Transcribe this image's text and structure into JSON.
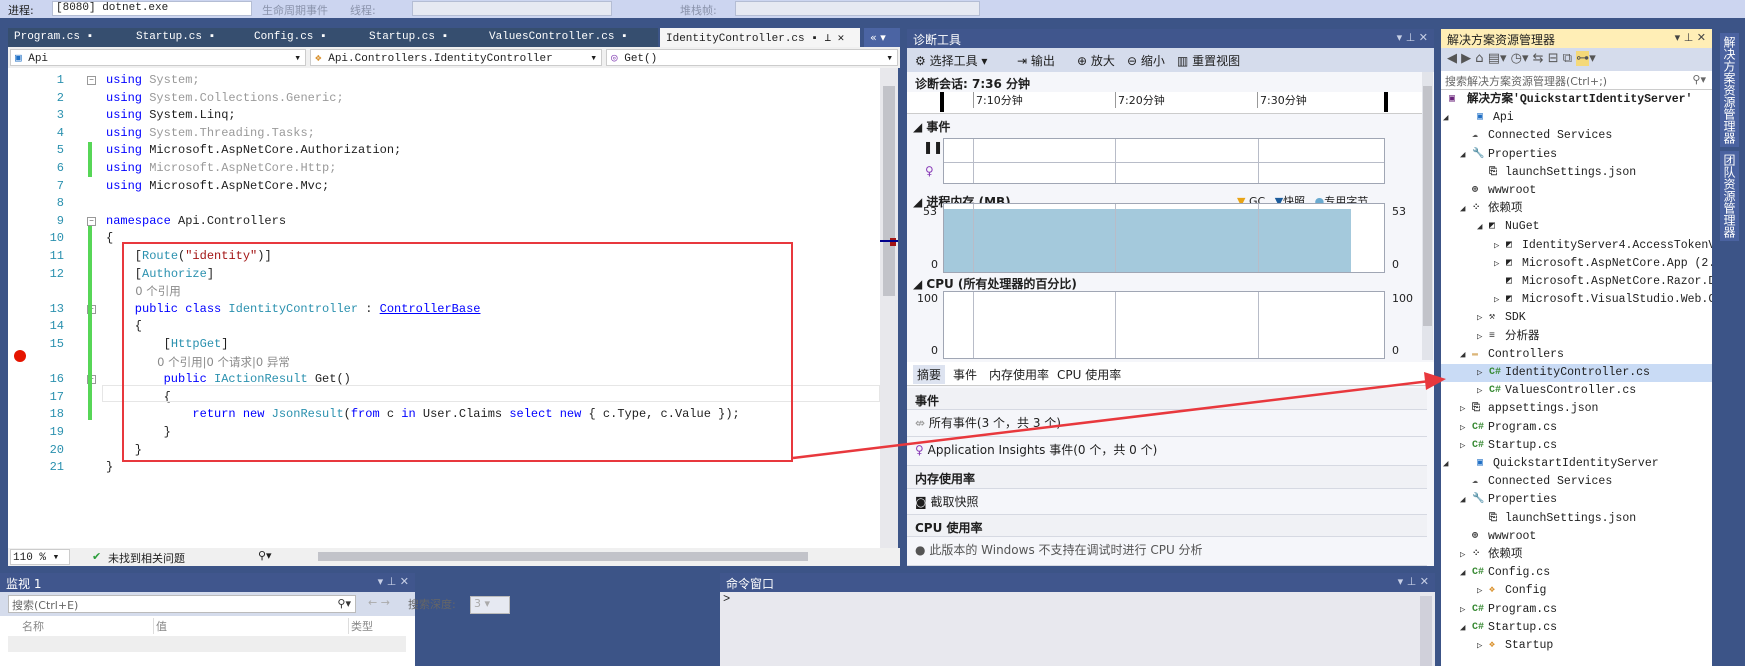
{
  "toolbar": {
    "process_label": "进程:",
    "process_value": "[8080] dotnet.exe",
    "lifecycle": "生命周期事件",
    "thread_label": "线程:",
    "stack_label": "堆栈帧:"
  },
  "tabs": [
    {
      "label": "Program.cs"
    },
    {
      "label": "Startup.cs"
    },
    {
      "label": "Config.cs"
    },
    {
      "label": "Startup.cs"
    },
    {
      "label": "ValuesController.cs"
    },
    {
      "label": "IdentityController.cs",
      "active": true
    }
  ],
  "nav": {
    "project": "Api",
    "class": "Api.Controllers.IdentityController",
    "member": "Get()"
  },
  "code": [
    {
      "n": "1",
      "t": [
        [
          "kw",
          "using "
        ],
        [
          "gr",
          "System;"
        ]
      ]
    },
    {
      "n": "2",
      "t": [
        [
          "kw",
          "using "
        ],
        [
          "gr",
          "System.Collections.Generic;"
        ]
      ]
    },
    {
      "n": "3",
      "t": [
        [
          "kw",
          "using "
        ],
        [
          "pl",
          "System.Linq;"
        ]
      ]
    },
    {
      "n": "4",
      "t": [
        [
          "kw",
          "using "
        ],
        [
          "gr",
          "System.Threading.Tasks;"
        ]
      ]
    },
    {
      "n": "5",
      "t": [
        [
          "kw",
          "using "
        ],
        [
          "pl",
          "Microsoft.AspNetCore.Authorization;"
        ]
      ]
    },
    {
      "n": "6",
      "t": [
        [
          "kw",
          "using "
        ],
        [
          "gr",
          "Microsoft.AspNetCore.Http;"
        ]
      ]
    },
    {
      "n": "7",
      "t": [
        [
          "kw",
          "using "
        ],
        [
          "pl",
          "Microsoft.AspNetCore.Mvc;"
        ]
      ]
    },
    {
      "n": "8",
      "t": []
    },
    {
      "n": "9",
      "t": [
        [
          "kw",
          "namespace "
        ],
        [
          "pl",
          "Api.Controllers"
        ]
      ]
    },
    {
      "n": "10",
      "t": [
        [
          "pl",
          "{"
        ]
      ]
    },
    {
      "n": "11",
      "t": [
        [
          "pl",
          "    ["
        ],
        [
          "ty",
          "Route"
        ],
        [
          "pl",
          "("
        ],
        [
          "st",
          "\"identity\""
        ],
        [
          "pl",
          ")]"
        ]
      ]
    },
    {
      "n": "12",
      "t": [
        [
          "pl",
          "    ["
        ],
        [
          "ty",
          "Authorize"
        ],
        [
          "pl",
          "]"
        ]
      ]
    },
    {
      "n": "",
      "t": [
        [
          "lens",
          "        0 个引用"
        ]
      ]
    },
    {
      "n": "13",
      "t": [
        [
          "kw",
          "    public class "
        ],
        [
          "ty",
          "IdentityController"
        ],
        [
          "pl",
          " : "
        ],
        [
          "lk",
          "ControllerBase"
        ]
      ]
    },
    {
      "n": "14",
      "t": [
        [
          "pl",
          "    {"
        ]
      ]
    },
    {
      "n": "15",
      "t": [
        [
          "pl",
          "        ["
        ],
        [
          "ty",
          "HttpGet"
        ],
        [
          "pl",
          "]"
        ]
      ]
    },
    {
      "n": "",
      "t": [
        [
          "lens",
          "              0 个引用|0 个请求|0 异常"
        ]
      ]
    },
    {
      "n": "16",
      "t": [
        [
          "kw",
          "        public "
        ],
        [
          "ty",
          "IActionResult "
        ],
        [
          "pl",
          "Get()"
        ]
      ]
    },
    {
      "n": "17",
      "t": [
        [
          "pl",
          "        {"
        ]
      ]
    },
    {
      "n": "18",
      "t": [
        [
          "kw",
          "            return new "
        ],
        [
          "ty",
          "JsonResult"
        ],
        [
          "pl",
          "("
        ],
        [
          "kw",
          "from "
        ],
        [
          "pl",
          "c "
        ],
        [
          "kw",
          "in "
        ],
        [
          "pl",
          "User.Claims "
        ],
        [
          "kw",
          "select new "
        ],
        [
          "pl",
          "{ c.Type, c.Value });"
        ]
      ]
    },
    {
      "n": "19",
      "t": [
        [
          "pl",
          "        }"
        ]
      ]
    },
    {
      "n": "20",
      "t": [
        [
          "pl",
          "    }"
        ]
      ]
    },
    {
      "n": "21",
      "t": [
        [
          "pl",
          "}"
        ]
      ]
    }
  ],
  "editor_status": {
    "zoom": "110 %",
    "issues": "未找到相关问题"
  },
  "diag": {
    "title": "诊断工具",
    "select_tools": "选择工具",
    "output": "输出",
    "zoom_in": "放大",
    "zoom_out": "缩小",
    "reset_view": "重置视图",
    "session": "诊断会话: 7:36 分钟",
    "timeline": [
      "7:10分钟",
      "7:20分钟",
      "7:30分钟"
    ],
    "events_label": "事件",
    "memory_label": "进程内存 (MB)",
    "legend": [
      "GC",
      "快照",
      "专用字节"
    ],
    "mem_max": "53",
    "mem_min": "0",
    "mem_value": 53,
    "cpu_label": "CPU (所有处理器的百分比)",
    "cpu_max": "100",
    "cpu_min": "0",
    "tabs": [
      "摘要",
      "事件",
      "内存使用率",
      "CPU 使用率"
    ],
    "sections": {
      "events": "事件",
      "all_events": "所有事件(3 个，共 3 个)",
      "ai_events": "Application Insights 事件(0 个，共 0 个)",
      "memory": "内存使用率",
      "snapshot": "截取快照",
      "cpu": "CPU 使用率",
      "cpu_note": "此版本的 Windows 不支持在调试时进行 CPU 分析"
    }
  },
  "solution": {
    "title": "解决方案资源管理器",
    "search_placeholder": "搜索解决方案资源管理器(Ctrl+;)",
    "items": [
      {
        "lvl": 0,
        "exp": "",
        "icon": "solution",
        "label": "解决方案'QuickstartIdentityServer'",
        "bold": true
      },
      {
        "lvl": 0,
        "exp": "open",
        "icon": "web-project",
        "label": "Api"
      },
      {
        "lvl": 1,
        "exp": "",
        "icon": "cloud",
        "label": "Connected Services"
      },
      {
        "lvl": 1,
        "exp": "open",
        "icon": "wrench",
        "label": "Properties"
      },
      {
        "lvl": 2,
        "exp": "",
        "icon": "json",
        "label": "launchSettings.json"
      },
      {
        "lvl": 1,
        "exp": "",
        "icon": "globe",
        "label": "wwwroot"
      },
      {
        "lvl": 1,
        "exp": "open",
        "icon": "dependencies",
        "label": "依赖项"
      },
      {
        "lvl": 2,
        "exp": "open",
        "icon": "package",
        "label": "NuGet"
      },
      {
        "lvl": 3,
        "exp": "closed",
        "icon": "package",
        "label": "IdentityServer4.AccessTokenV"
      },
      {
        "lvl": 3,
        "exp": "closed",
        "icon": "package",
        "label": "Microsoft.AspNetCore.App (2."
      },
      {
        "lvl": 3,
        "exp": "",
        "icon": "package",
        "label": "Microsoft.AspNetCore.Razor.D"
      },
      {
        "lvl": 3,
        "exp": "closed",
        "icon": "package",
        "label": "Microsoft.VisualStudio.Web.C"
      },
      {
        "lvl": 2,
        "exp": "closed",
        "icon": "sdk",
        "label": "SDK"
      },
      {
        "lvl": 2,
        "exp": "closed",
        "icon": "analyzer",
        "label": "分析器"
      },
      {
        "lvl": 1,
        "exp": "open",
        "icon": "folder",
        "label": "Controllers"
      },
      {
        "lvl": 2,
        "exp": "closed",
        "icon": "csharp",
        "label": "IdentityController.cs",
        "selected": true
      },
      {
        "lvl": 2,
        "exp": "closed",
        "icon": "csharp",
        "label": "ValuesController.cs"
      },
      {
        "lvl": 1,
        "exp": "closed",
        "icon": "json",
        "label": "appsettings.json"
      },
      {
        "lvl": 1,
        "exp": "closed",
        "icon": "csharp",
        "label": "Program.cs"
      },
      {
        "lvl": 1,
        "exp": "closed",
        "icon": "csharp",
        "label": "Startup.cs"
      },
      {
        "lvl": 0,
        "exp": "open",
        "icon": "web-project",
        "label": "QuickstartIdentityServer"
      },
      {
        "lvl": 1,
        "exp": "",
        "icon": "cloud",
        "label": "Connected Services"
      },
      {
        "lvl": 1,
        "exp": "open",
        "icon": "wrench",
        "label": "Properties"
      },
      {
        "lvl": 2,
        "exp": "",
        "icon": "json",
        "label": "launchSettings.json"
      },
      {
        "lvl": 1,
        "exp": "",
        "icon": "globe",
        "label": "wwwroot"
      },
      {
        "lvl": 1,
        "exp": "closed",
        "icon": "dependencies",
        "label": "依赖项"
      },
      {
        "lvl": 1,
        "exp": "open",
        "icon": "csharp",
        "label": "Config.cs"
      },
      {
        "lvl": 2,
        "exp": "closed",
        "icon": "class",
        "label": "Config"
      },
      {
        "lvl": 1,
        "exp": "closed",
        "icon": "csharp",
        "label": "Program.cs"
      },
      {
        "lvl": 1,
        "exp": "open",
        "icon": "csharp",
        "label": "Startup.cs"
      },
      {
        "lvl": 2,
        "exp": "closed",
        "icon": "class",
        "label": "Startup"
      }
    ]
  },
  "side_tabs": [
    "解决方案资源管理器",
    "团队资源管理器"
  ],
  "watch": {
    "title": "监视 1",
    "search_placeholder": "搜索(Ctrl+E)",
    "depth_label": "搜索深度:",
    "depth": "3",
    "columns": [
      "名称",
      "值",
      "类型"
    ]
  },
  "command": {
    "title": "命令窗口",
    "prompt": ">"
  },
  "colors": {
    "annotation": "#e8383d",
    "frame": "#40568d",
    "keyword": "#0000ff",
    "type": "#2b91af"
  }
}
